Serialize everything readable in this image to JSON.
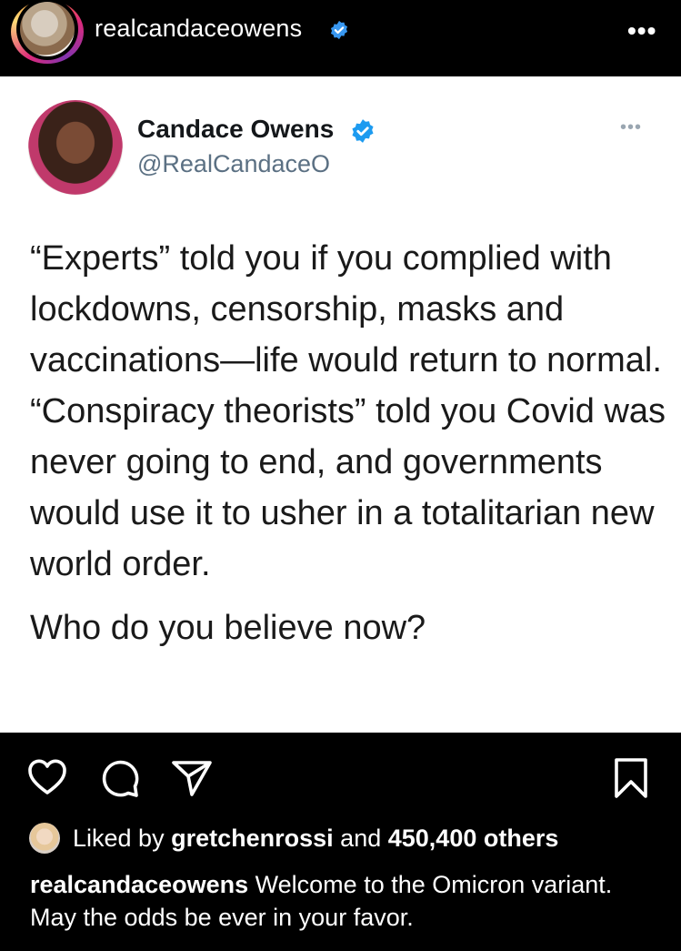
{
  "header": {
    "username": "realcandaceowens",
    "more_icon": "more-horizontal-icon",
    "verified_icon": "verified-badge-icon"
  },
  "tweet": {
    "display_name": "Candace Owens",
    "handle": "@RealCandaceO",
    "more_label": "•••",
    "paragraphs": [
      "“Experts” told you if you complied with lockdowns, censorship, masks and vaccinations—life would return to normal.",
      "“Conspiracy theorists” told you Covid was never going to end, and governments would use it to usher in a totalitarian new world order.",
      "Who do you believe now?"
    ]
  },
  "actions": {
    "like_icon": "heart-icon",
    "comment_icon": "comment-icon",
    "share_icon": "send-icon",
    "save_icon": "bookmark-icon"
  },
  "likes": {
    "prefix": "Liked by",
    "user": "gretchenrossi",
    "connector": "and",
    "count": "450,400 others"
  },
  "caption": {
    "username": "realcandaceowens",
    "text": "Welcome to the Omicron variant. May the odds be ever in your favor."
  },
  "colors": {
    "verified": "#3897f0",
    "background": "#000000",
    "card": "#ffffff",
    "handle": "#5b7083"
  }
}
